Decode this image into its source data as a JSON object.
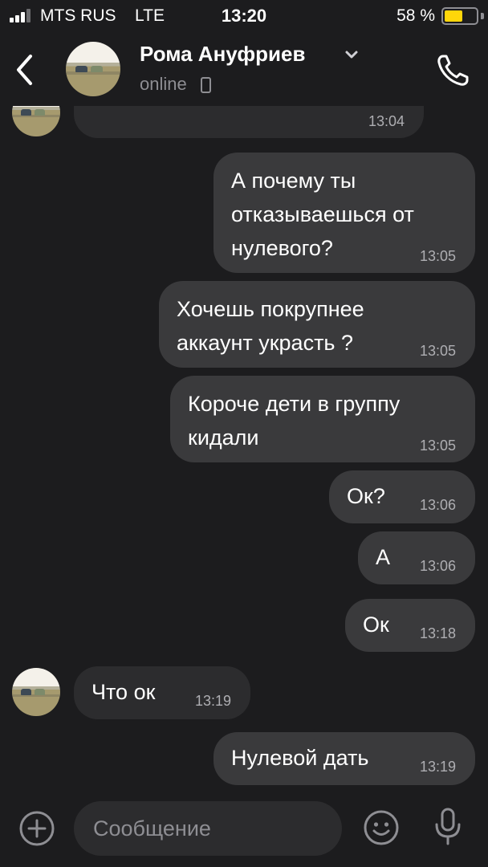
{
  "status_bar": {
    "carrier": "MTS RUS",
    "network": "LTE",
    "time": "13:20",
    "battery_text": "58 %",
    "battery_level": 0.58,
    "signal_bars": 3,
    "battery_color": "#ffd60a"
  },
  "header": {
    "contact_name": "Рома Ануфриев",
    "status": "online",
    "icons": {
      "back": "chevron-left-icon",
      "dropdown": "chevron-down-icon",
      "device": "mobile-phone-icon",
      "call": "phone-icon"
    }
  },
  "messages": [
    {
      "direction": "in",
      "lines": [],
      "time": "13:04"
    },
    {
      "direction": "out",
      "lines": [
        "А почему ты",
        "отказываешься от",
        "нулевого?"
      ],
      "time": "13:05"
    },
    {
      "direction": "out",
      "lines": [
        "Хочешь покрупнее",
        "аккаунт украсть ?"
      ],
      "time": "13:05"
    },
    {
      "direction": "out",
      "lines": [
        "Короче дети в группу",
        "кидали"
      ],
      "time": "13:05"
    },
    {
      "direction": "out",
      "lines": [
        "Ок?"
      ],
      "time": "13:06"
    },
    {
      "direction": "out",
      "lines": [
        "А"
      ],
      "time": "13:06"
    },
    {
      "direction": "out",
      "lines": [
        "Ок"
      ],
      "time": "13:18"
    },
    {
      "direction": "in",
      "lines": [
        "Что ок"
      ],
      "time": "13:19"
    },
    {
      "direction": "out",
      "lines": [
        "Нулевой дать"
      ],
      "time": "13:19"
    }
  ],
  "composer": {
    "placeholder": "Сообщение",
    "icons": {
      "attach": "plus-circle-icon",
      "emoji": "emoji-icon",
      "voice": "microphone-icon"
    }
  },
  "colors": {
    "background": "#1c1c1e",
    "outgoing_bubble": "#3a3a3c",
    "incoming_bubble": "#2c2c2e",
    "secondary_text": "#8e8e93"
  }
}
